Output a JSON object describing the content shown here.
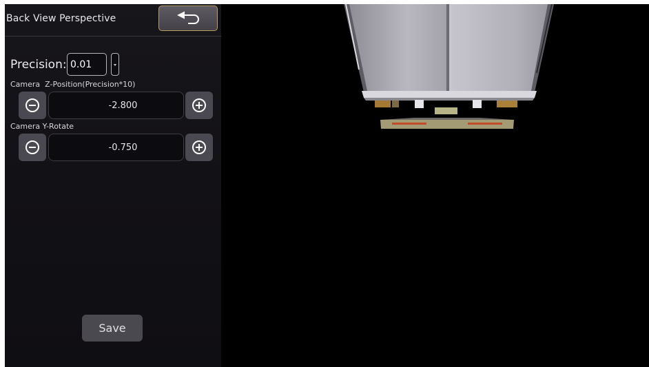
{
  "panel": {
    "title": "Back View Perspective",
    "back_icon": "back-arrow-icon",
    "precision": {
      "label": "Precision:",
      "value": "0.01"
    },
    "fields": [
      {
        "label": "Camera  Z-Position(Precision*10)",
        "value": "-2.800",
        "minus_icon": "minus-circle-icon",
        "plus_icon": "plus-circle-icon"
      },
      {
        "label": "Camera Y-Rotate",
        "value": "-0.750",
        "minus_icon": "minus-circle-icon",
        "plus_icon": "plus-circle-icon"
      }
    ],
    "save_label": "Save"
  },
  "colors": {
    "panel_bg": "#141318",
    "button_bg": "#4a4850",
    "back_border": "#b8a064",
    "viewport_bg": "#000000"
  }
}
